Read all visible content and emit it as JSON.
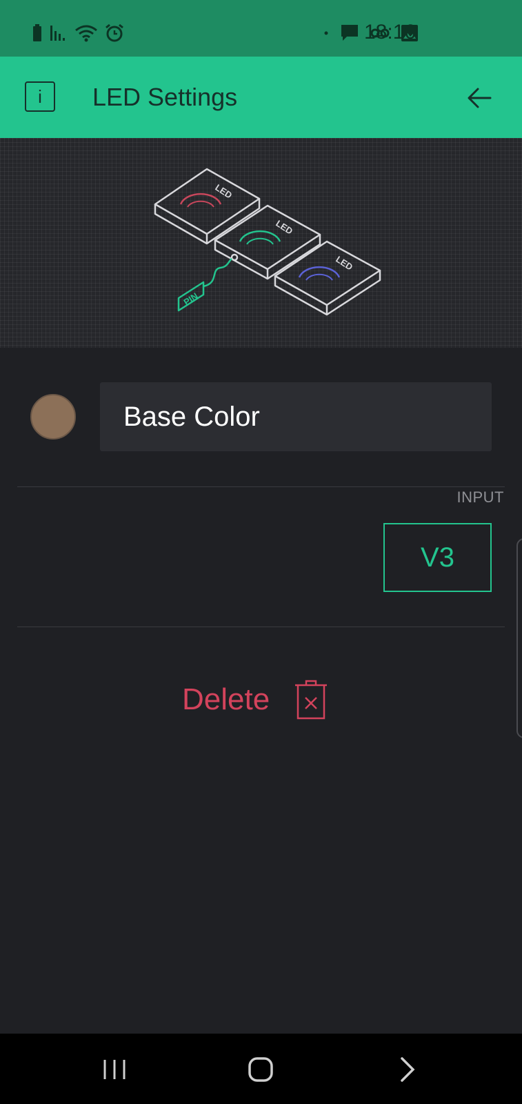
{
  "status_bar": {
    "time": "18:16",
    "icons": [
      "battery-icon",
      "signal-icon",
      "wifi-icon",
      "alarm-icon",
      "dot-icon",
      "message-icon",
      "voicemail-icon",
      "image-icon"
    ]
  },
  "app_bar": {
    "info_label": "i",
    "title": "LED Settings",
    "back_icon": "arrow-left-icon"
  },
  "hero": {
    "led_label": "LED",
    "pin_label": "PIN",
    "led_colors": [
      "#c8475c",
      "#23c48e",
      "#5b62d6"
    ]
  },
  "settings": {
    "color_value": "#8c7058",
    "name_value": "Base Color",
    "input_label": "INPUT",
    "pin_value": "V3",
    "delete_label": "Delete"
  },
  "colors": {
    "accent": "#23c48e",
    "status_bar": "#1e8c62",
    "danger": "#d3435c",
    "background": "#1f2024"
  },
  "nav_bar": {
    "buttons": [
      "recent-apps-icon",
      "home-icon",
      "forward-icon"
    ]
  }
}
